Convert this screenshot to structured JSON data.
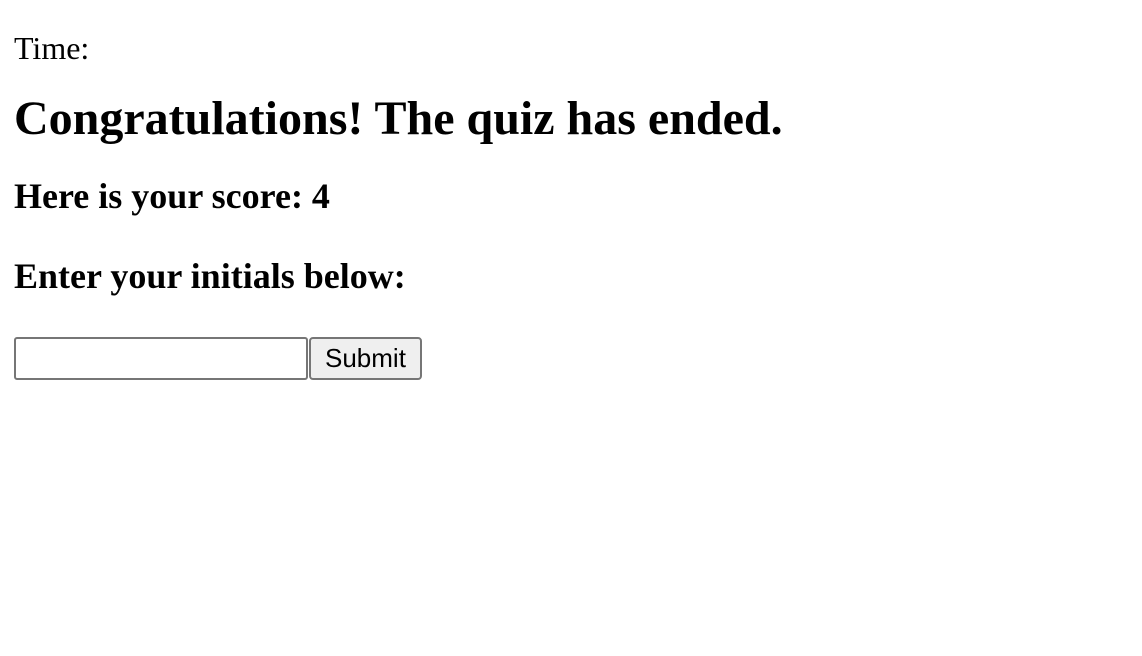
{
  "timer": {
    "label": "Time:"
  },
  "result": {
    "heading": "Congratulations! The quiz has ended.",
    "score_text": "Here is your score: 4",
    "prompt": "Enter your initials below:"
  },
  "form": {
    "initials_value": "",
    "initials_placeholder": "",
    "submit_label": "Submit"
  }
}
